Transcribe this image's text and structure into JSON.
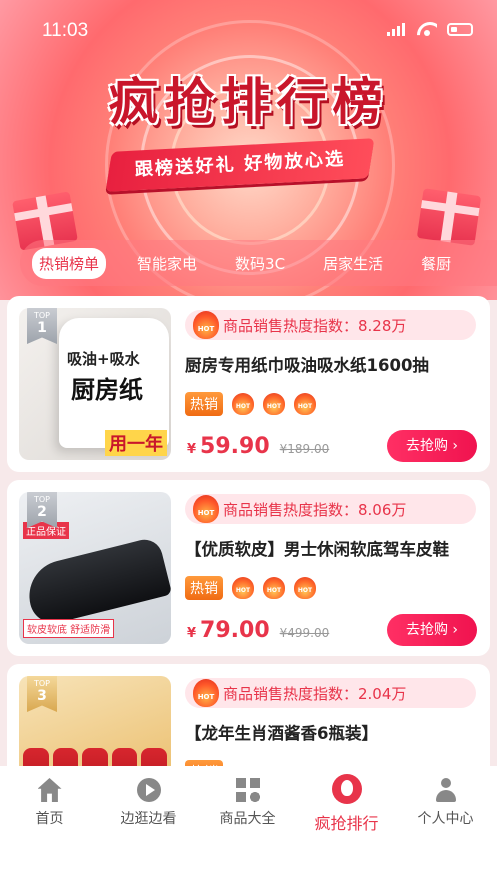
{
  "status": {
    "time": "11:03"
  },
  "banner": {
    "title": "疯抢排行榜",
    "subtitle": "跟榜送好礼  好物放心选"
  },
  "tabs": [
    "热销榜单",
    "智能家电",
    "数码3C",
    "居家生活",
    "餐厨"
  ],
  "products": [
    {
      "rank": "1",
      "top_label": "TOP",
      "heat_label": "商品销售热度指数：8.28万",
      "name": "厨房专用纸巾吸油吸水纸1600抽",
      "tag": "热销",
      "price": "59.90",
      "old_price": "¥189.00",
      "buy": "去抢购",
      "img_text1": "吸油+吸水",
      "img_text2": "厨房纸",
      "img_badge": "用一年"
    },
    {
      "rank": "2",
      "top_label": "TOP",
      "heat_label": "商品销售热度指数：8.06万",
      "name": "【优质软皮】男士休闲软底驾车皮鞋",
      "tag": "热销",
      "price": "79.00",
      "old_price": "¥499.00",
      "buy": "去抢购",
      "img_text1": "正品保证",
      "img_text2": "软皮软底 舒适防滑"
    },
    {
      "rank": "3",
      "top_label": "TOP",
      "heat_label": "商品销售热度指数：2.04万",
      "name": "【龙年生肖酒酱香6瓶装】",
      "tag": "热销",
      "price": "",
      "old_price": "",
      "buy": ""
    }
  ],
  "yen": "¥",
  "hot_icon_text": "HOT",
  "nav": [
    {
      "label": "首页",
      "icon": "home-icon"
    },
    {
      "label": "边逛边看",
      "icon": "play-icon"
    },
    {
      "label": "商品大全",
      "icon": "grid-search-icon"
    },
    {
      "label": "疯抢排行",
      "icon": "fire-icon"
    },
    {
      "label": "个人中心",
      "icon": "user-icon"
    }
  ],
  "colors": {
    "accent": "#e8344a",
    "buy_button": "#f0134f",
    "hot_tag": "#f06b13"
  }
}
